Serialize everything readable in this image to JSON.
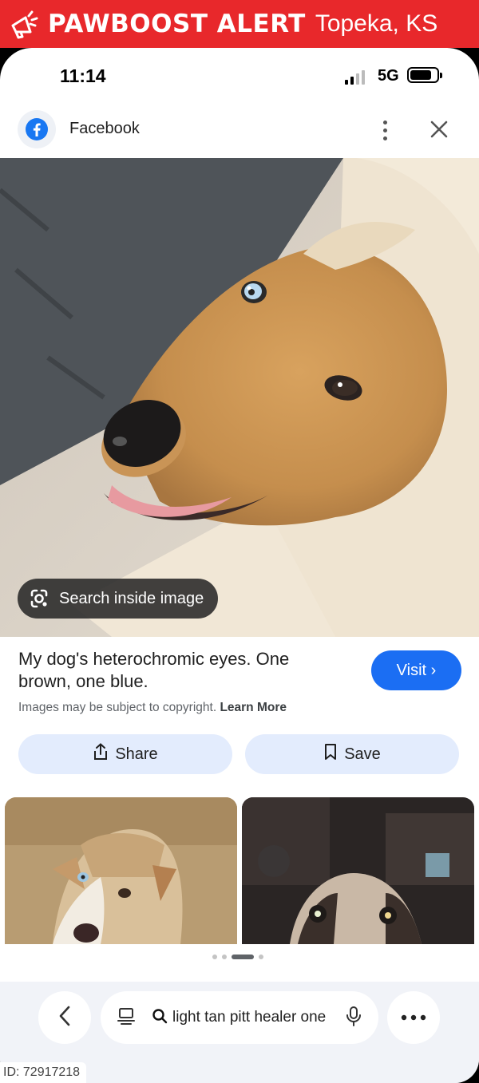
{
  "banner": {
    "brand": "PAWBOOST ALERT",
    "location": "Topeka, KS",
    "color": "#e8282b",
    "icon": "megaphone-icon"
  },
  "status_bar": {
    "time": "11:14",
    "network": "5G"
  },
  "app_bar": {
    "title": "Facebook",
    "icons": [
      "facebook-logo-icon",
      "more-vert-icon",
      "close-icon"
    ]
  },
  "hero": {
    "lens_label": "Search inside image"
  },
  "info": {
    "caption": "My dog's heterochromic eyes. One brown, one blue.",
    "visit_label": "Visit ›",
    "copyright_text": "Images may be subject to copyright.",
    "learn_more": "Learn More",
    "share_label": "Share",
    "save_label": "Save",
    "accent": "#1b6ef3"
  },
  "pager": {
    "count": 4,
    "active": 2
  },
  "bottom_bar": {
    "query": "light tan pitt healer one"
  },
  "footer": {
    "id_text": "ID: 72917218"
  }
}
